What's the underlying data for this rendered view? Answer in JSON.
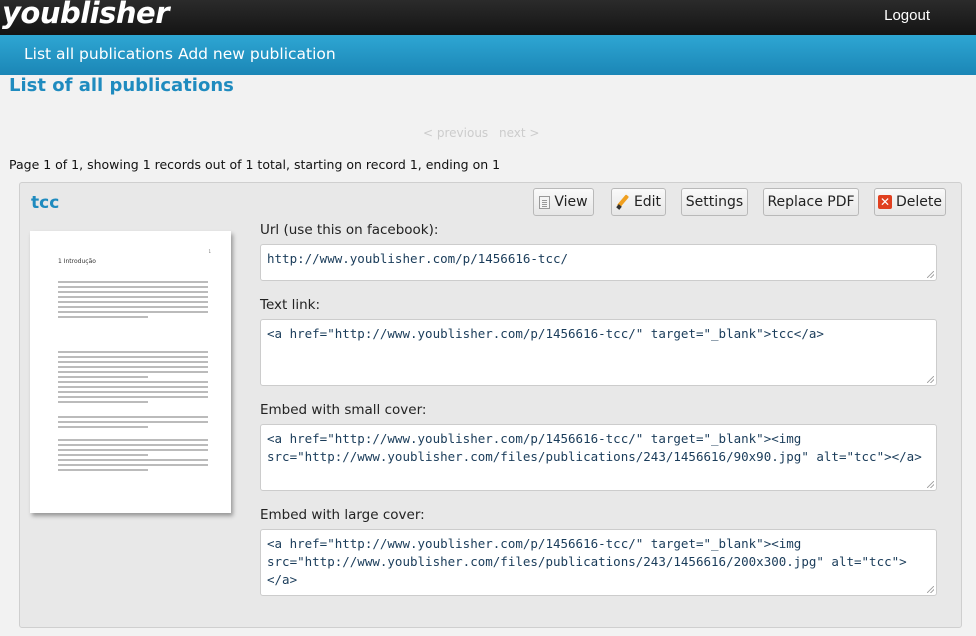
{
  "header": {
    "logo": "youblisher",
    "logout_label": "Logout"
  },
  "nav": {
    "items": [
      {
        "label": "List all publications"
      },
      {
        "label": "Add new publication"
      }
    ]
  },
  "page": {
    "title": "List of all publications",
    "pager_prev": "< previous",
    "pager_next": "next >",
    "records_info": "Page 1 of 1, showing 1 records out of 1 total, starting on record 1, ending on 1"
  },
  "publication": {
    "title": "tcc",
    "buttons": {
      "view": "View",
      "edit": "Edit",
      "settings": "Settings",
      "replace_pdf": "Replace PDF",
      "delete": "Delete"
    },
    "cover": {
      "heading": "1  Introdução",
      "page_number": "1"
    },
    "fields": [
      {
        "label": "Url (use this on facebook):",
        "value": "http://www.youblisher.com/p/1456616-tcc/"
      },
      {
        "label": "Text link:",
        "value": "<a href=\"http://www.youblisher.com/p/1456616-tcc/\" target=\"_blank\">tcc</a>"
      },
      {
        "label": "Embed with small cover:",
        "value": "<a href=\"http://www.youblisher.com/p/1456616-tcc/\" target=\"_blank\"><img src=\"http://www.youblisher.com/files/publications/243/1456616/90x90.jpg\" alt=\"tcc\"></a>"
      },
      {
        "label": "Embed with large cover:",
        "value": "<a href=\"http://www.youblisher.com/p/1456616-tcc/\" target=\"_blank\"><img src=\"http://www.youblisher.com/files/publications/243/1456616/200x300.jpg\" alt=\"tcc\"></a>"
      }
    ]
  },
  "colors": {
    "accent": "#1f8bbf",
    "nav_bg": "#2596c8",
    "header_bg": "#1a1a1a"
  }
}
